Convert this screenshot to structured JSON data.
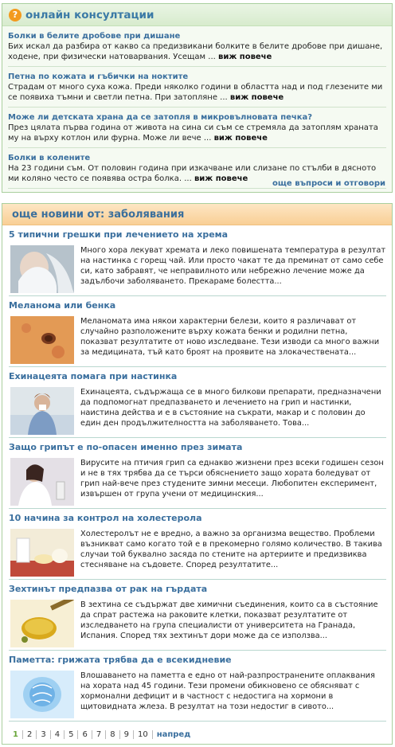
{
  "consult": {
    "title": "онлайн консултации",
    "items": [
      {
        "title": "Болки в белите дробове при дишане",
        "text": "Бих искал да разбира от какво са предизвикани болките в белите дробове при дишане, ходене, при физически натоварвания. Усещам ...",
        "more": "виж повече"
      },
      {
        "title": "Петна по кожата и гъбички на ноктите",
        "text": "Страдам от много суха кожа. Преди няколко години в областта над и под глезените ми се появиха тъмни и светли петна. При затопляне ...",
        "more": "виж повече"
      },
      {
        "title": "Може ли детската храна да се затопля в микровълновата печка?",
        "text": "През цялата първа година от живота на сина си съм се стремяла да затоплям храната му на върху котлон или фурна. Може ли вече ...",
        "more": "виж повече"
      },
      {
        "title": "Болки в колените",
        "text": "На 23 години съм. От половин година при изкачване или слизане по стълби в дясното ми коляно често се появява остра болка. ...",
        "more": "виж повече"
      }
    ],
    "footer": "още въпроси и отговори"
  },
  "news": {
    "title": "още новини от: заболявания",
    "items": [
      {
        "title": "5 типични грешки при лечението на хрема",
        "text": "Много хора лекуват хремата и леко повишената температура в резултат на настинка с горещ чай. Или просто чакат те да преминат от само себе си, като забравят, че неправилното или небрежно лечение може да задълбочи заболяването. Прекараме болестта..."
      },
      {
        "title": "Меланома или бенка",
        "text": "Меланомата има някои характерни белези, които я различават от случайно разположените върху кожата бенки и родилни петна, показват резултатите от ново изследване. Тези изводи са много важни за медицината, тъй като броят на проявите на злокачествената..."
      },
      {
        "title": "Ехинацеята помага при настинка",
        "text": "Ехинацеята, съдържаща се в много билкови препарати, предназначени да подпомогнат предпазването и лечението на грип и настинки, наистина действа и е в състояние на съкрати, макар и с половин до един ден продължителността на заболяването. Това..."
      },
      {
        "title": "Защо грипът е по-опасен именно през зимата",
        "text": "Вирусите на птичия грип са еднакво жизнени през всеки годишен сезон и не в тях трябва да се търси обяснението защо хората боледуват от грип най-вече през студените зимни месеци. Любопитен експеримент, извършен от група учени от медицинския..."
      },
      {
        "title": "10 начина за контрол на холестерола",
        "text": "Холестеролът не е вредно, а важно за организма вещество. Проблеми възникват само когато той е в прекомерно голямо количество. В такива случаи той буквално засяда по стените на артериите и предизвиква стесняване на съдовете. Според резултатите..."
      },
      {
        "title": "Зехтинът предпазва от рак на гърдата",
        "text": "В зехтина се съдържат две химични съединения, които са в състояние да спрат растежа на раковите клетки, показват резултатите от изследването на група специалисти от университета на Гранада, Испания. Според тях зехтинът дори може да се използва..."
      },
      {
        "title": "Паметта: грижата трябва да е всекидневие",
        "text": "Влошаването на паметта е едно от най-разпространените оплаквания на хората над 45 години. Тези промени обикновено се обясняват с хормонални дефицит и в частност с недостига на хормони в щитовидната жлеза. В резултат на този недостиг в сивото..."
      }
    ],
    "pager": {
      "pages": [
        "1",
        "2",
        "3",
        "4",
        "5",
        "6",
        "7",
        "8",
        "9",
        "10"
      ],
      "next": "напред"
    }
  }
}
